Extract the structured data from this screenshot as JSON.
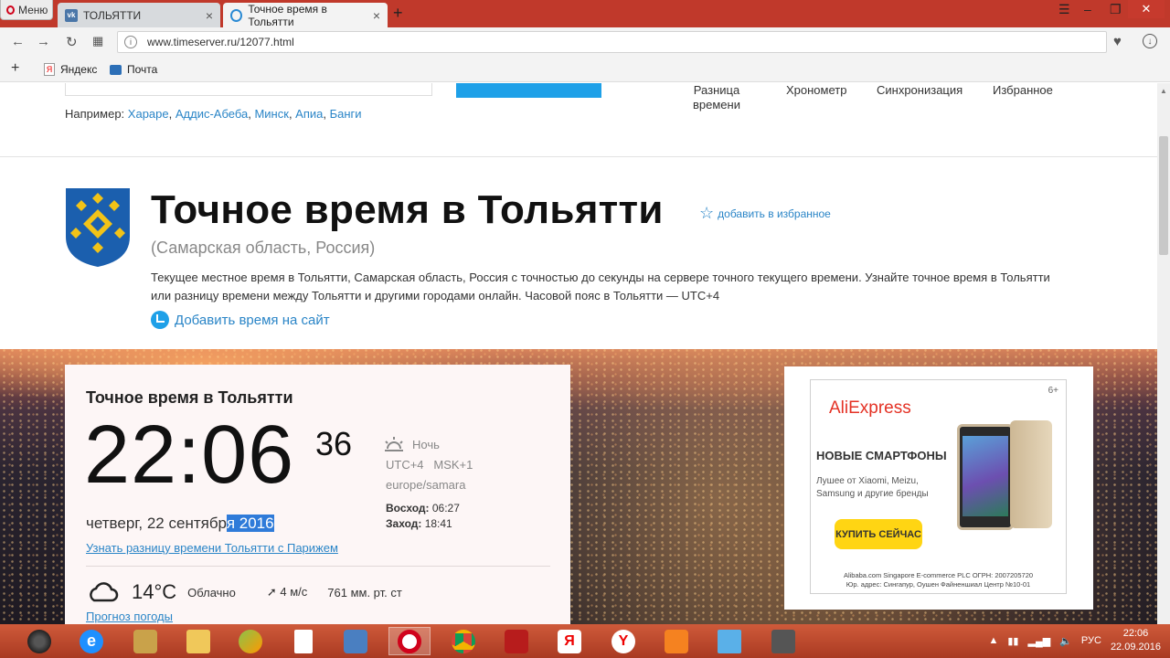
{
  "browser": {
    "menu_label": "Меню",
    "tabs": [
      {
        "title": "ТОЛЬЯТТИ",
        "close": "×"
      },
      {
        "title": "Точное время в Тольятти",
        "close": "×"
      }
    ],
    "new_tab": "+",
    "url": "www.timeserver.ru/12077.html",
    "bookmarks": [
      {
        "label": "Яндекс"
      },
      {
        "label": "Почта"
      }
    ]
  },
  "topnav": {
    "examples_prefix": "Например:",
    "examples": [
      "Хараре",
      "Аддис-Абеба",
      "Минск",
      "Апиа",
      "Банги"
    ],
    "items": [
      {
        "label": "Разница\nвремени"
      },
      {
        "label": "Хронометр"
      },
      {
        "label": "Синхронизация"
      },
      {
        "label": "Избранное"
      }
    ]
  },
  "header": {
    "title": "Точное время в Тольятти",
    "favorite_link": "добавить в избранное",
    "region": "(Самарская область, Россия)",
    "description": "Текущее местное время в Тольятти, Самарская область, Россия с точностью до секунды на сервере точного текущего времени. Узнайте точное время в Тольятти или разницу времени между Тольятти и другими городами онлайн. Часовой пояс в Тольятти — UTC+4",
    "add_time_link": "Добавить время на сайт"
  },
  "timecard": {
    "title": "Точное время в Тольятти",
    "time": "22:06",
    "seconds": "36",
    "date_plain": "четверг, 22 сентябр",
    "date_selected": "я 2016",
    "diff_link": "Узнать разницу времени Тольятти с Парижем",
    "daypart": "Ночь",
    "tz": "UTC+4   MSK+1",
    "zone": "europe/samara",
    "sunrise_label": "Восход:",
    "sunrise": "06:27",
    "sunset_label": "Заход:",
    "sunset": "18:41",
    "weather": {
      "temp": "14°C",
      "condition": "Облачно",
      "wind": "4 м/с",
      "pressure": "761 мм. рт. ст"
    },
    "forecast_link": "Прогноз погоды"
  },
  "ad": {
    "brand": "AliExpress",
    "age": "6+",
    "headline": "НОВЫЕ СМАРТФОНЫ",
    "subtext": "Лушее от Xiaomi, Meizu, Samsung и другие бренды",
    "button": "КУПИТЬ СЕЙЧАС",
    "legal_1": "Alibaba.com Singapore E-commerce PLC ОГРН: 2007205720",
    "legal_2": "Юр. адрес: Сингапур, Оушен Файненшиал Центр №10-01"
  },
  "taskbar": {
    "lang": "РУС",
    "time": "22:06",
    "date": "22.09.2016"
  },
  "colors": {
    "tabbar": "#c0392b",
    "link": "#2a85c7",
    "selection": "#2f7bd9",
    "taskbar": "#b8452a"
  }
}
